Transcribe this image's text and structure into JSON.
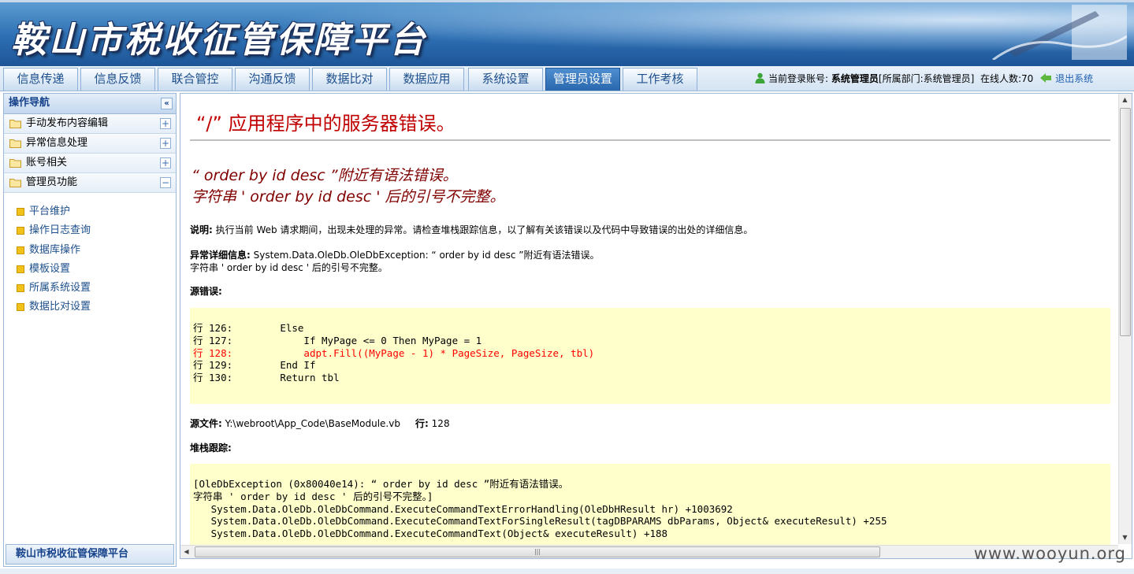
{
  "header": {
    "app_title": "鞍山市税收征管保障平台"
  },
  "nav": {
    "tabs": [
      {
        "label": "信息传递"
      },
      {
        "label": "信息反馈"
      },
      {
        "label": "联合管控"
      },
      {
        "label": "沟通反馈"
      },
      {
        "label": "数据比对"
      },
      {
        "label": "数据应用"
      },
      {
        "label": "系统设置"
      },
      {
        "label": "管理员设置",
        "active": true
      },
      {
        "label": "工作考核"
      }
    ],
    "user": {
      "prefix": "当前登录账号:",
      "name": "系统管理员",
      "dept": "[所属部门:系统管理员]",
      "online": "在线人数:70",
      "logout": "退出系统"
    }
  },
  "sidebar": {
    "title": "操作导航",
    "collapse_glyph": "«",
    "groups": [
      {
        "label": "手动发布内容编辑"
      },
      {
        "label": "异常信息处理"
      },
      {
        "label": "账号相关"
      },
      {
        "label": "管理员功能",
        "expanded": true
      }
    ],
    "items": [
      {
        "label": "平台维护"
      },
      {
        "label": "操作日志查询"
      },
      {
        "label": "数据库操作"
      },
      {
        "label": "模板设置"
      },
      {
        "label": "所属系统设置"
      },
      {
        "label": "数据比对设置"
      }
    ],
    "footer": "鞍山市税收征管保障平台"
  },
  "error_page": {
    "title": "“/” 应用程序中的服务器错误。",
    "h2_line1": "“ order by id desc ”附近有语法错误。",
    "h2_line2": "字符串 ' order by id desc ' 后的引号不完整。",
    "desc_label": "说明:",
    "desc_text": " 执行当前 Web 请求期间，出现未处理的异常。请检查堆栈跟踪信息，以了解有关该错误以及代码中导致错误的出处的详细信息。",
    "exc_label": "异常详细信息:",
    "exc_text1": " System.Data.OleDb.OleDbException: “ order by id desc ”附近有语法错误。",
    "exc_text2": "字符串 ' order by id desc ' 后的引号不完整。",
    "src_label": "源错误:",
    "code_lines": [
      {
        "text": "行 126:        Else"
      },
      {
        "text": "行 127:            If MyPage <= 0 Then MyPage = 1"
      },
      {
        "text": "行 128:            adpt.Fill((MyPage - 1) * PageSize, PageSize, tbl)",
        "highlight": true
      },
      {
        "text": "行 129:        End If"
      },
      {
        "text": "行 130:        Return tbl"
      }
    ],
    "srcfile_label": "源文件:",
    "srcfile_value": " Y:\\webroot\\App_Code\\BaseModule.vb",
    "line_label": "行:",
    "line_value": " 128",
    "stack_label": "堆栈跟踪:",
    "stack_lines": [
      "[OleDbException (0x80040e14): “ order by id desc ”附近有语法错误。",
      "字符串 ' order by id desc ' 后的引号不完整。]",
      "   System.Data.OleDb.OleDbCommand.ExecuteCommandTextErrorHandling(OleDbHResult hr) +1003692",
      "   System.Data.OleDb.OleDbCommand.ExecuteCommandTextForSingleResult(tagDBPARAMS dbParams, Object& executeResult) +255",
      "   System.Data.OleDb.OleDbCommand.ExecuteCommandText(Object& executeResult) +188"
    ]
  },
  "watermark": "www.wooyun.org",
  "colors": {
    "accent": "#2d6fb3",
    "error_title": "#c00000",
    "error_h2": "#800000",
    "code_bg": "#ffffcc",
    "highlight_line": "#ff0000"
  }
}
